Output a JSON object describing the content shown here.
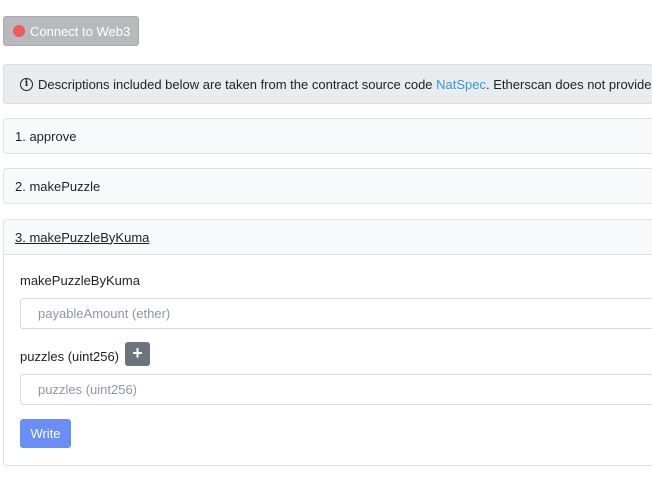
{
  "connect_button": {
    "label": "Connect to Web3",
    "status_color": "#f0595e"
  },
  "notice": {
    "text_before": "Descriptions included below are taken from the contract source code ",
    "link": "NatSpec",
    "text_after": ". Etherscan does not provide"
  },
  "functions": [
    {
      "label": "1. approve"
    },
    {
      "label": "2. makePuzzle"
    },
    {
      "label": "3. makePuzzleByKuma",
      "fields": [
        {
          "label": "makePuzzleByKuma",
          "placeholder": "payableAmount (ether)"
        },
        {
          "label": "puzzles (uint256)",
          "placeholder": "puzzles (uint256)"
        }
      ],
      "add_button": "+",
      "write_button": "Write"
    }
  ],
  "colors": {
    "accent": "#3498db",
    "write": "#6b8df6",
    "secondary": "#6c757d"
  }
}
